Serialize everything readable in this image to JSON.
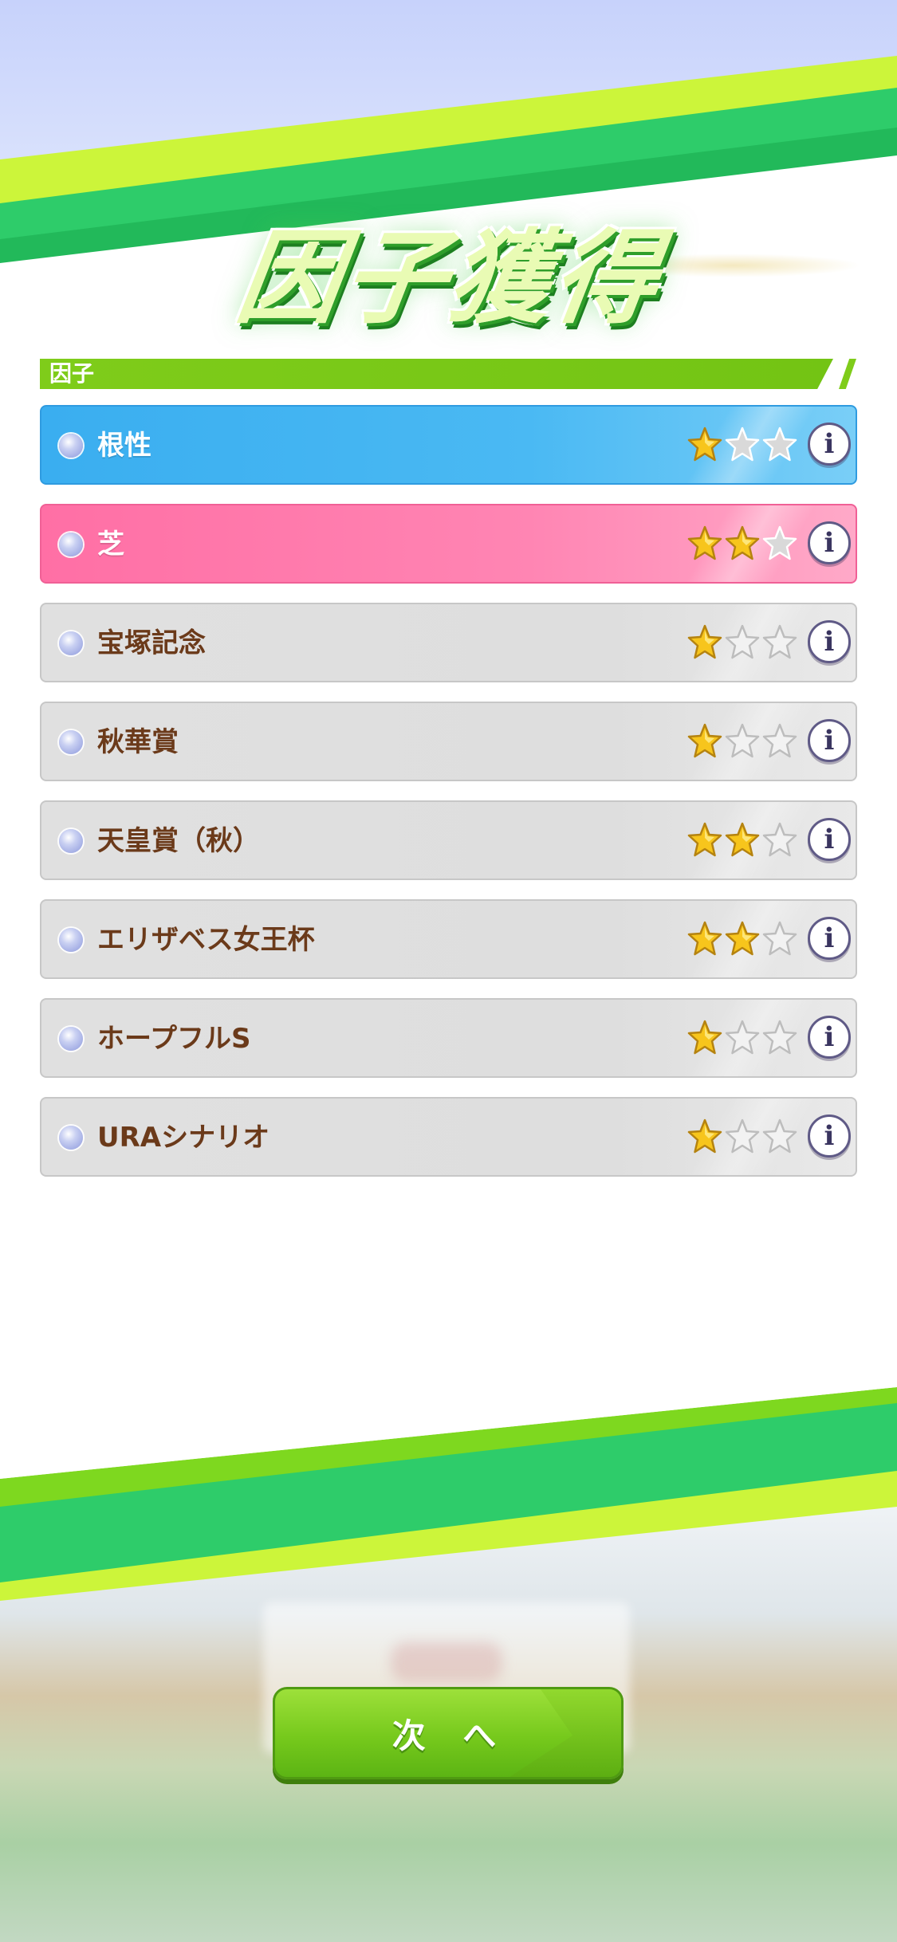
{
  "screen": {
    "title": "因子獲得",
    "section_label": "因子"
  },
  "factors": [
    {
      "name": "根性",
      "stars": 1,
      "max_stars": 3,
      "color": "blue"
    },
    {
      "name": "芝",
      "stars": 2,
      "max_stars": 3,
      "color": "pink"
    },
    {
      "name": "宝塚記念",
      "stars": 1,
      "max_stars": 3,
      "color": "gray"
    },
    {
      "name": "秋華賞",
      "stars": 1,
      "max_stars": 3,
      "color": "gray"
    },
    {
      "name": "天皇賞（秋）",
      "stars": 2,
      "max_stars": 3,
      "color": "gray"
    },
    {
      "name": "エリザベス女王杯",
      "stars": 2,
      "max_stars": 3,
      "color": "gray"
    },
    {
      "name": "ホープフルS",
      "stars": 1,
      "max_stars": 3,
      "color": "gray"
    },
    {
      "name": "URAシナリオ",
      "stars": 1,
      "max_stars": 3,
      "color": "gray"
    }
  ],
  "info_button_glyph": "i",
  "next_button": {
    "label": "次 へ"
  },
  "colors": {
    "accent_green": "#7fcc1a",
    "stripe_dark_green": "#2ecc6a",
    "stripe_lime": "#ccf53a",
    "row_blue": "#4ab9f3",
    "row_pink": "#ff85b3",
    "row_gray": "#dedede",
    "star_gold": "#f7c51c"
  }
}
